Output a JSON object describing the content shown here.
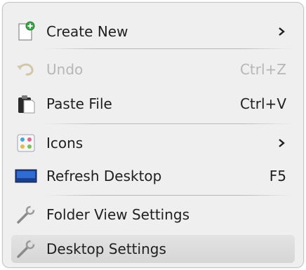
{
  "menu": {
    "items": [
      {
        "label": "Create New",
        "shortcut": "",
        "submenu": true,
        "icon": "new-document-icon",
        "disabled": false
      },
      {
        "label": "Undo",
        "shortcut": "Ctrl+Z",
        "submenu": false,
        "icon": "undo-icon",
        "disabled": true
      },
      {
        "label": "Paste File",
        "shortcut": "Ctrl+V",
        "submenu": false,
        "icon": "paste-icon",
        "disabled": false
      },
      {
        "label": "Icons",
        "shortcut": "",
        "submenu": true,
        "icon": "icons-grid-icon",
        "disabled": false
      },
      {
        "label": "Refresh Desktop",
        "shortcut": "F5",
        "submenu": false,
        "icon": "monitor-icon",
        "disabled": false
      },
      {
        "label": "Folder View Settings",
        "shortcut": "",
        "submenu": false,
        "icon": "wrench-icon",
        "disabled": false
      },
      {
        "label": "Desktop Settings",
        "shortcut": "",
        "submenu": false,
        "icon": "wrench-icon",
        "disabled": false,
        "highlighted": true
      }
    ],
    "colors": {
      "background": "#efefef",
      "text": "#1f1f1f",
      "disabled_text": "#b6b6b6",
      "highlight": "#d9d9d9"
    }
  }
}
